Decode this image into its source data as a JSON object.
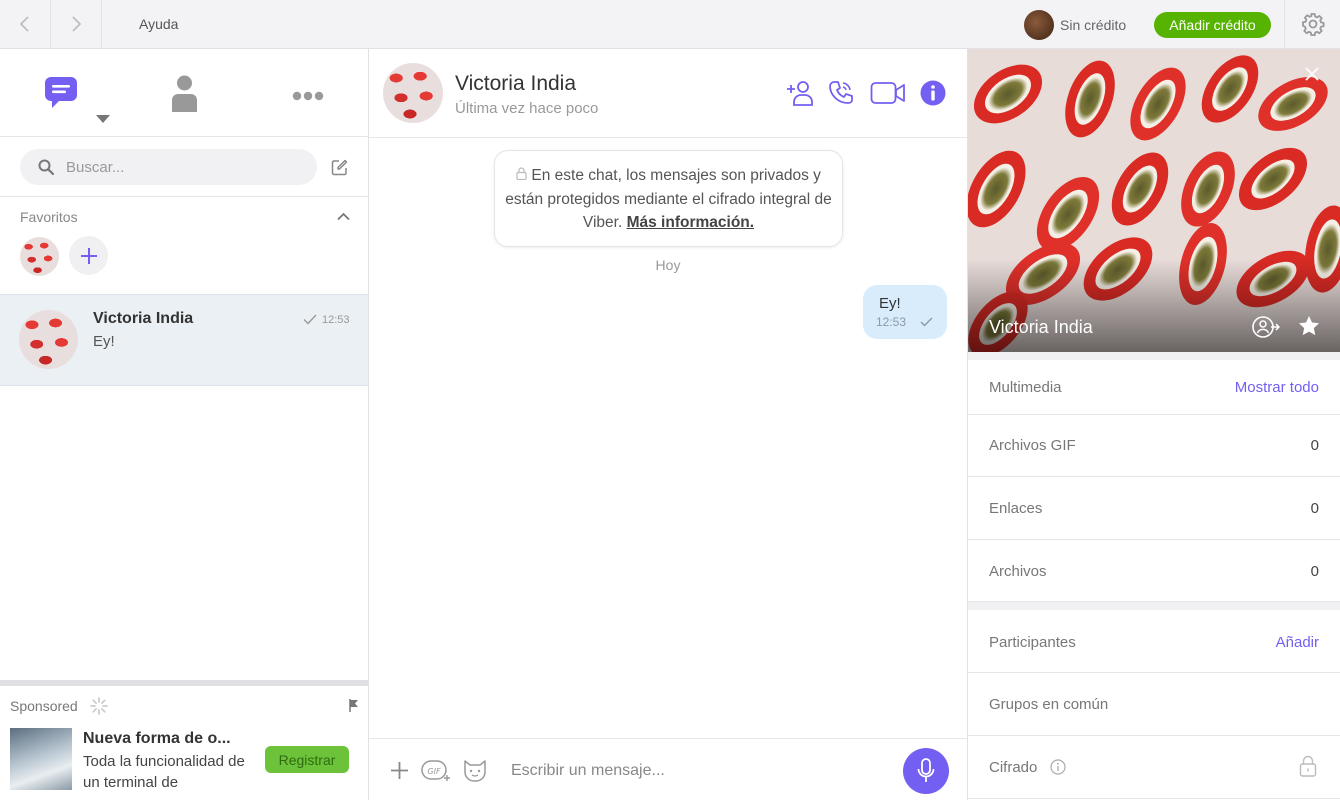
{
  "topbar": {
    "help": "Ayuda",
    "credit_status": "Sin crédito",
    "add_credit": "Añadir crédito"
  },
  "sidebar": {
    "search_placeholder": "Buscar...",
    "favorites_label": "Favoritos",
    "chats": [
      {
        "name": "Victoria India",
        "last_message": "Ey!",
        "time": "12:53"
      }
    ],
    "sponsored": {
      "label": "Sponsored",
      "title": "Nueva forma de o...",
      "text": "Toda la funcionalidad de un terminal de",
      "button": "Registrar"
    }
  },
  "chat": {
    "contact_name": "Victoria India",
    "contact_status": "Última vez hace poco",
    "encryption_notice": "En este chat, los mensajes son privados y están protegidos mediante el cifrado integral de Viber.",
    "encryption_link": "Más información.",
    "day_label": "Hoy",
    "messages": [
      {
        "text": "Ey!",
        "time": "12:53",
        "outgoing": true
      }
    ],
    "composer_placeholder": "Escribir un mensaje..."
  },
  "details": {
    "name": "Victoria India",
    "media_label": "Multimedia",
    "media_link": "Mostrar todo",
    "gif_label": "Archivos GIF",
    "gif_count": "0",
    "links_label": "Enlaces",
    "links_count": "0",
    "files_label": "Archivos",
    "files_count": "0",
    "participants_label": "Participantes",
    "participants_link": "Añadir",
    "common_groups_label": "Grupos en común",
    "encryption_label": "Cifrado"
  },
  "colors": {
    "accent": "#7360f2",
    "credit_button": "#56b300",
    "bubble": "#d9ecfb",
    "selected_chat": "#eaf0f4"
  }
}
